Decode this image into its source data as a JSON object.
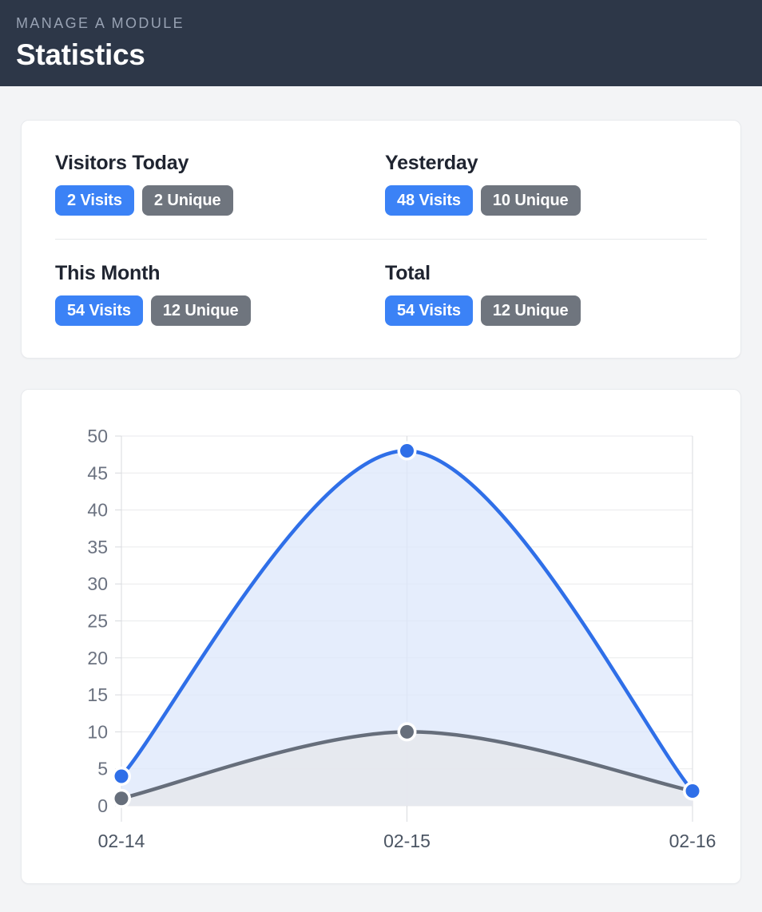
{
  "header": {
    "eyebrow": "MANAGE A MODULE",
    "title": "Statistics",
    "bg_color": "#2d3748"
  },
  "colors": {
    "primary": "#3b82f6",
    "secondary": "#6f757e",
    "line_visits": "#2f6fe8",
    "line_unique": "#666e7b",
    "page_bg": "#f3f4f6",
    "card_bg": "#ffffff"
  },
  "stats": {
    "rows": [
      {
        "blocks": [
          {
            "title": "Visitors Today",
            "visits_label": "2 Visits",
            "unique_label": "2 Unique"
          },
          {
            "title": "Yesterday",
            "visits_label": "48 Visits",
            "unique_label": "10 Unique"
          }
        ]
      },
      {
        "blocks": [
          {
            "title": "This Month",
            "visits_label": "54 Visits",
            "unique_label": "12 Unique"
          },
          {
            "title": "Total",
            "visits_label": "54 Visits",
            "unique_label": "12 Unique"
          }
        ]
      }
    ]
  },
  "chart_data": {
    "type": "line",
    "title": "",
    "xlabel": "",
    "ylabel": "",
    "categories": [
      "02-14",
      "02-15",
      "02-16"
    ],
    "series": [
      {
        "name": "Visits",
        "values": [
          4,
          48,
          2
        ],
        "color": "#2f6fe8",
        "fill": "#dce7fb"
      },
      {
        "name": "Unique",
        "values": [
          1,
          10,
          2
        ],
        "color": "#666e7b",
        "fill": "#e6e8ec"
      }
    ],
    "ylim": [
      0,
      50
    ],
    "yticks": [
      0,
      5,
      10,
      15,
      20,
      25,
      30,
      35,
      40,
      45,
      50
    ],
    "grid": true,
    "legend": "none",
    "smoothing": "spline",
    "markers": true
  }
}
